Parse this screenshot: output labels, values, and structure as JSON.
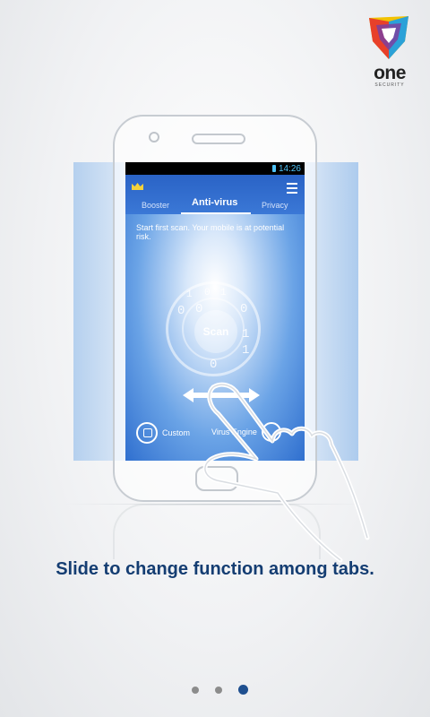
{
  "brand": {
    "name": "one",
    "sub": "SECURITY"
  },
  "phone": {
    "time": "14:26",
    "tabs": [
      "Booster",
      "Anti-virus",
      "Privacy"
    ],
    "status_text": "Start first scan. Your mobile is at potential risk.",
    "scan_label": "Scan",
    "custom_label": "Custom",
    "engine_label": "Virus Engine",
    "dial_digits": [
      "1",
      "0",
      "1",
      "0",
      "0",
      "0",
      "1",
      "1",
      "0"
    ]
  },
  "caption": "Slide to change function among tabs.",
  "pager": {
    "count": 3,
    "active": 3
  },
  "colors": {
    "caption": "#143d72",
    "active_dot": "#1f4f8f",
    "screen": "#3b78d6"
  }
}
